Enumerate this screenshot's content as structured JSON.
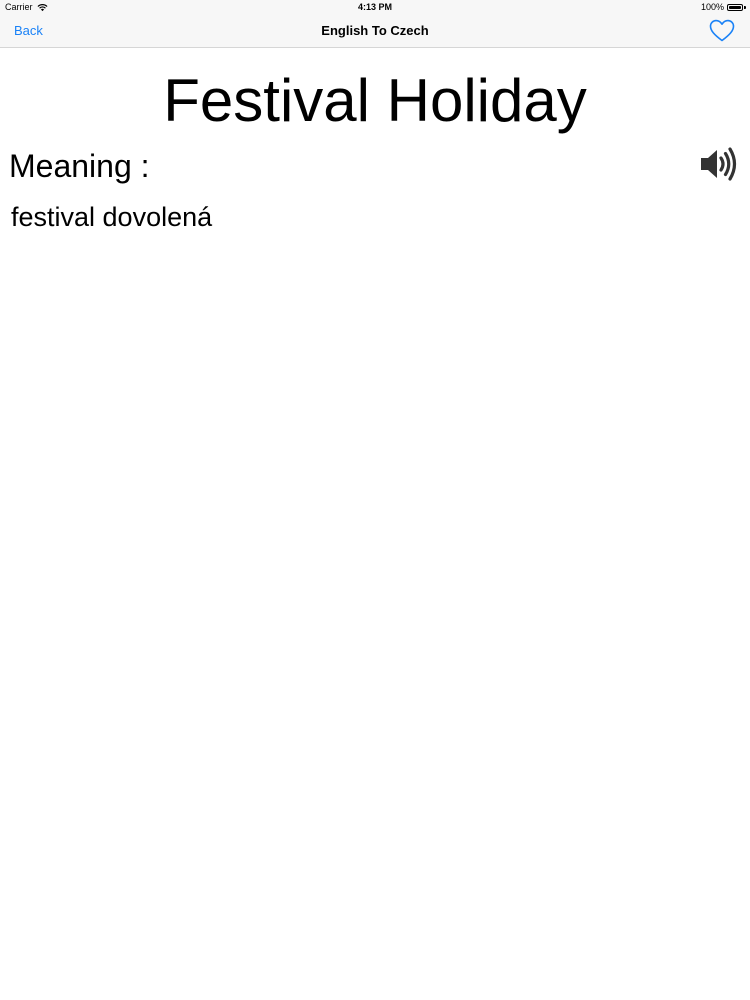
{
  "status_bar": {
    "carrier": "Carrier",
    "time": "4:13 PM",
    "battery": "100%",
    "wifi_icon": "wifi-icon",
    "battery_icon": "battery-icon"
  },
  "nav": {
    "back_label": "Back",
    "title": "English To Czech",
    "favorite_icon": "heart-outline-icon"
  },
  "word": {
    "term": "Festival Holiday",
    "meaning_label": "Meaning :",
    "meaning": "festival dovolená",
    "speaker_icon": "speaker-icon"
  },
  "colors": {
    "accent": "#1a82f7",
    "bar_background": "#f7f7f7",
    "text": "#000000"
  }
}
